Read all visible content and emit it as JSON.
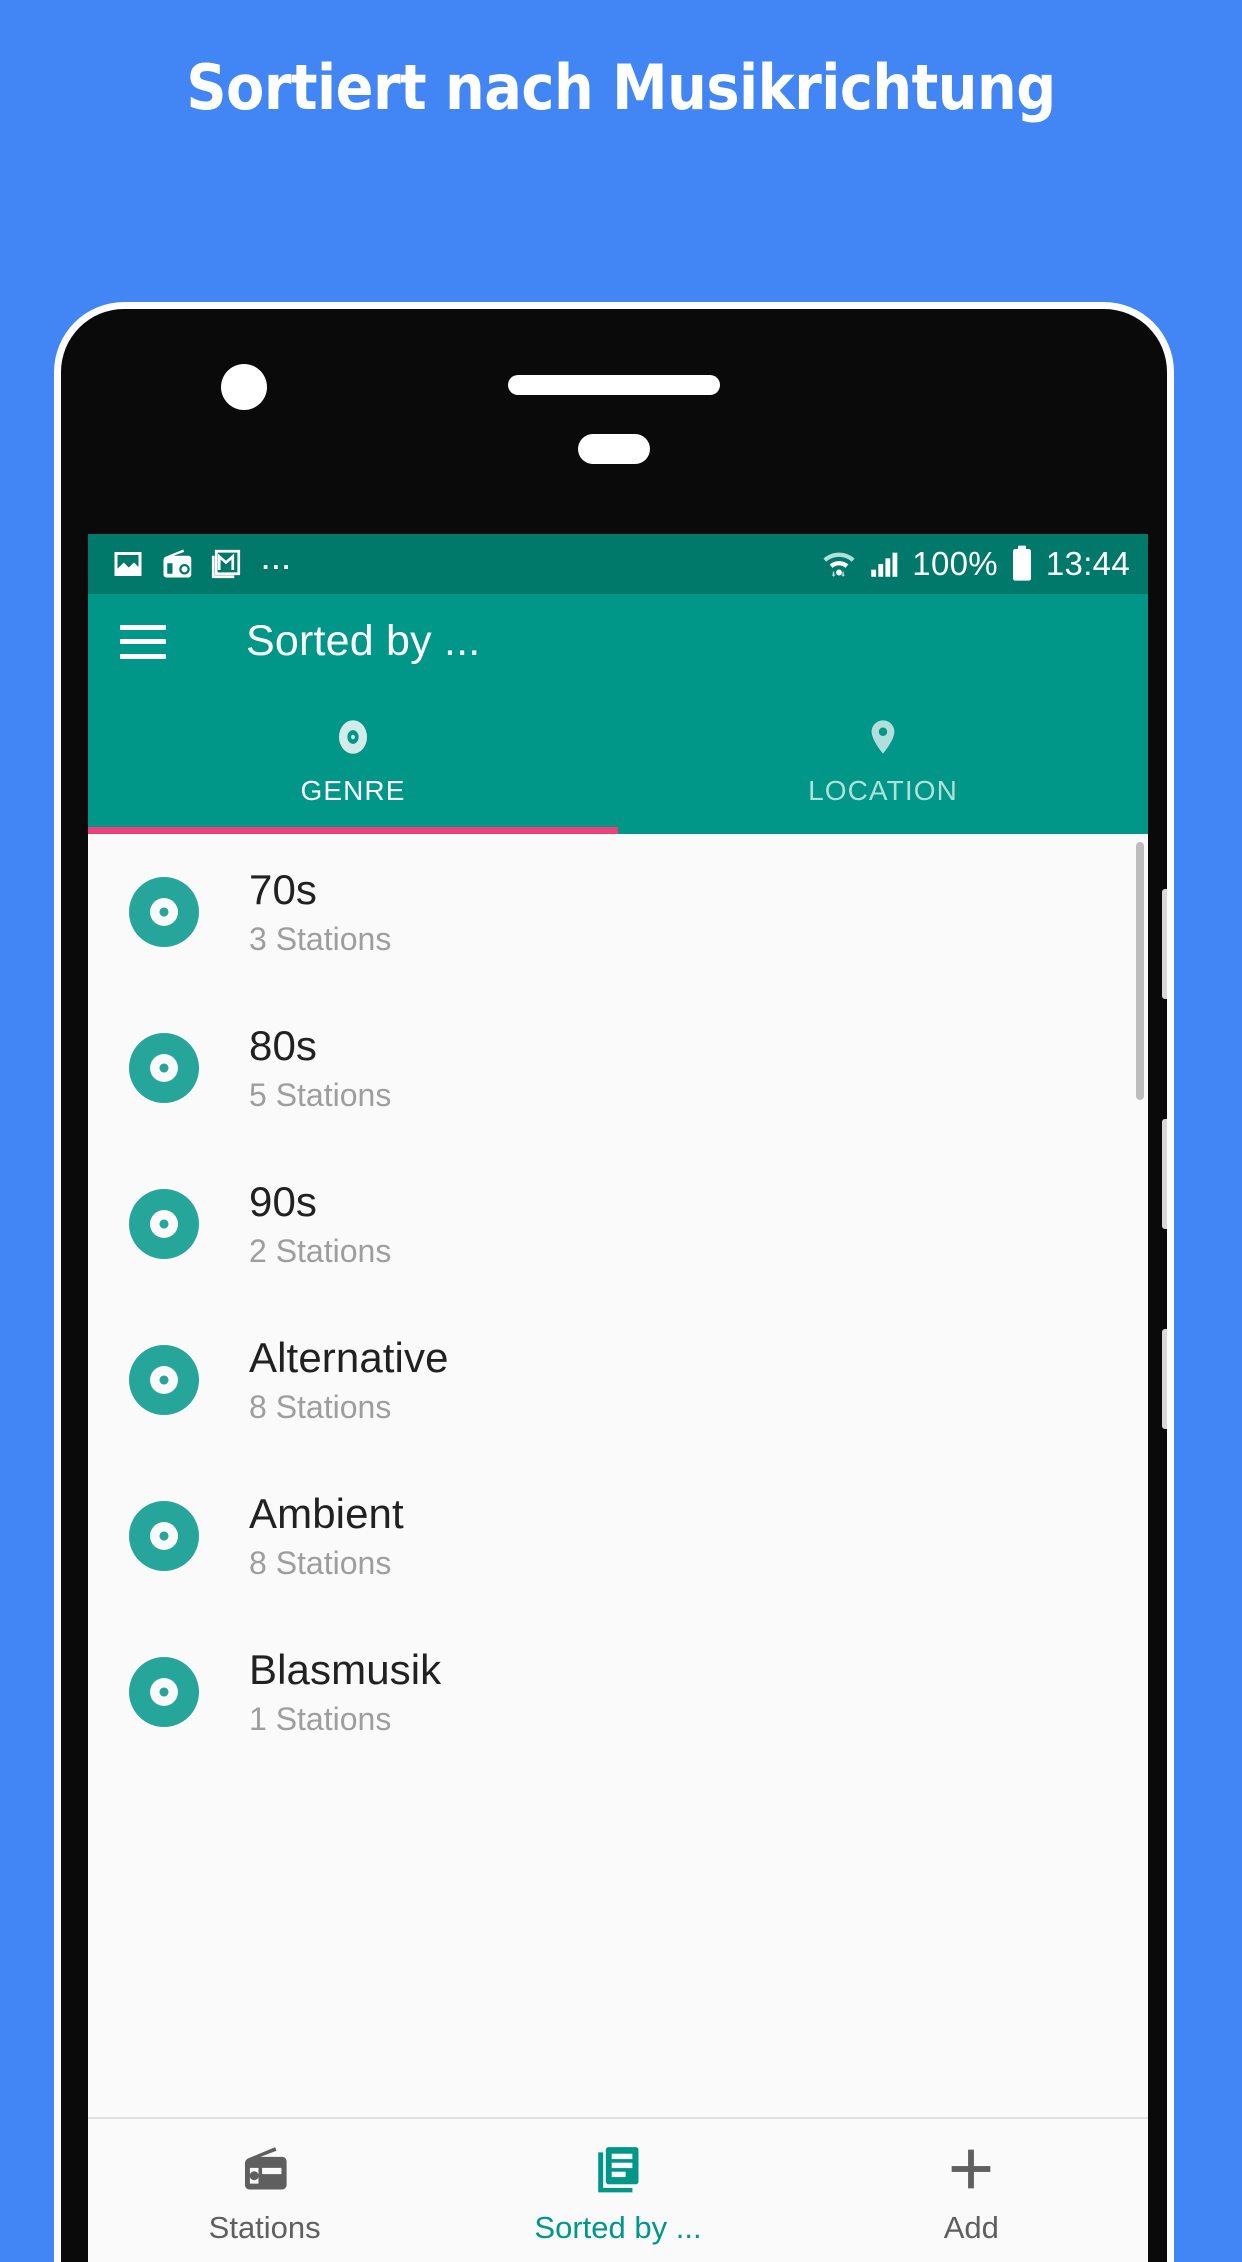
{
  "promo": {
    "headline": "Sortiert nach Musikrichtung",
    "background_color": "#4285f4"
  },
  "phone": {
    "status_bar": {
      "background_color": "#00796b",
      "left_icons": [
        "image-icon",
        "radio-icon",
        "gmail-icon"
      ],
      "overflow": "...",
      "wifi_icon": "wifi-icon",
      "signal_icon": "cellular-signal-icon",
      "battery_percent": "100%",
      "battery_icon": "battery-full-icon",
      "time": "13:44"
    },
    "app_bar": {
      "background_color": "#009688",
      "menu_icon": "hamburger-menu-icon",
      "title": "Sorted by ..."
    },
    "tabs": {
      "indicator_color": "#ec407a",
      "items": [
        {
          "label": "GENRE",
          "icon": "vinyl-disc-icon",
          "active": true
        },
        {
          "label": "LOCATION",
          "icon": "map-pin-icon",
          "active": false
        }
      ]
    },
    "genre_list": {
      "accent_color": "#26a69a",
      "items": [
        {
          "title": "70s",
          "subtitle": "3 Stations"
        },
        {
          "title": "80s",
          "subtitle": "5 Stations"
        },
        {
          "title": "90s",
          "subtitle": "2 Stations"
        },
        {
          "title": "Alternative",
          "subtitle": "8 Stations"
        },
        {
          "title": "Ambient",
          "subtitle": "8 Stations"
        },
        {
          "title": "Blasmusik",
          "subtitle": "1 Stations"
        }
      ]
    },
    "bottom_nav": {
      "active_color": "#009688",
      "inactive_color": "#5f5f5f",
      "items": [
        {
          "label": "Stations",
          "icon": "radio-icon",
          "active": false
        },
        {
          "label": "Sorted by ...",
          "icon": "list-document-icon",
          "active": true
        },
        {
          "label": "Add",
          "icon": "plus-icon",
          "active": false
        }
      ]
    }
  }
}
